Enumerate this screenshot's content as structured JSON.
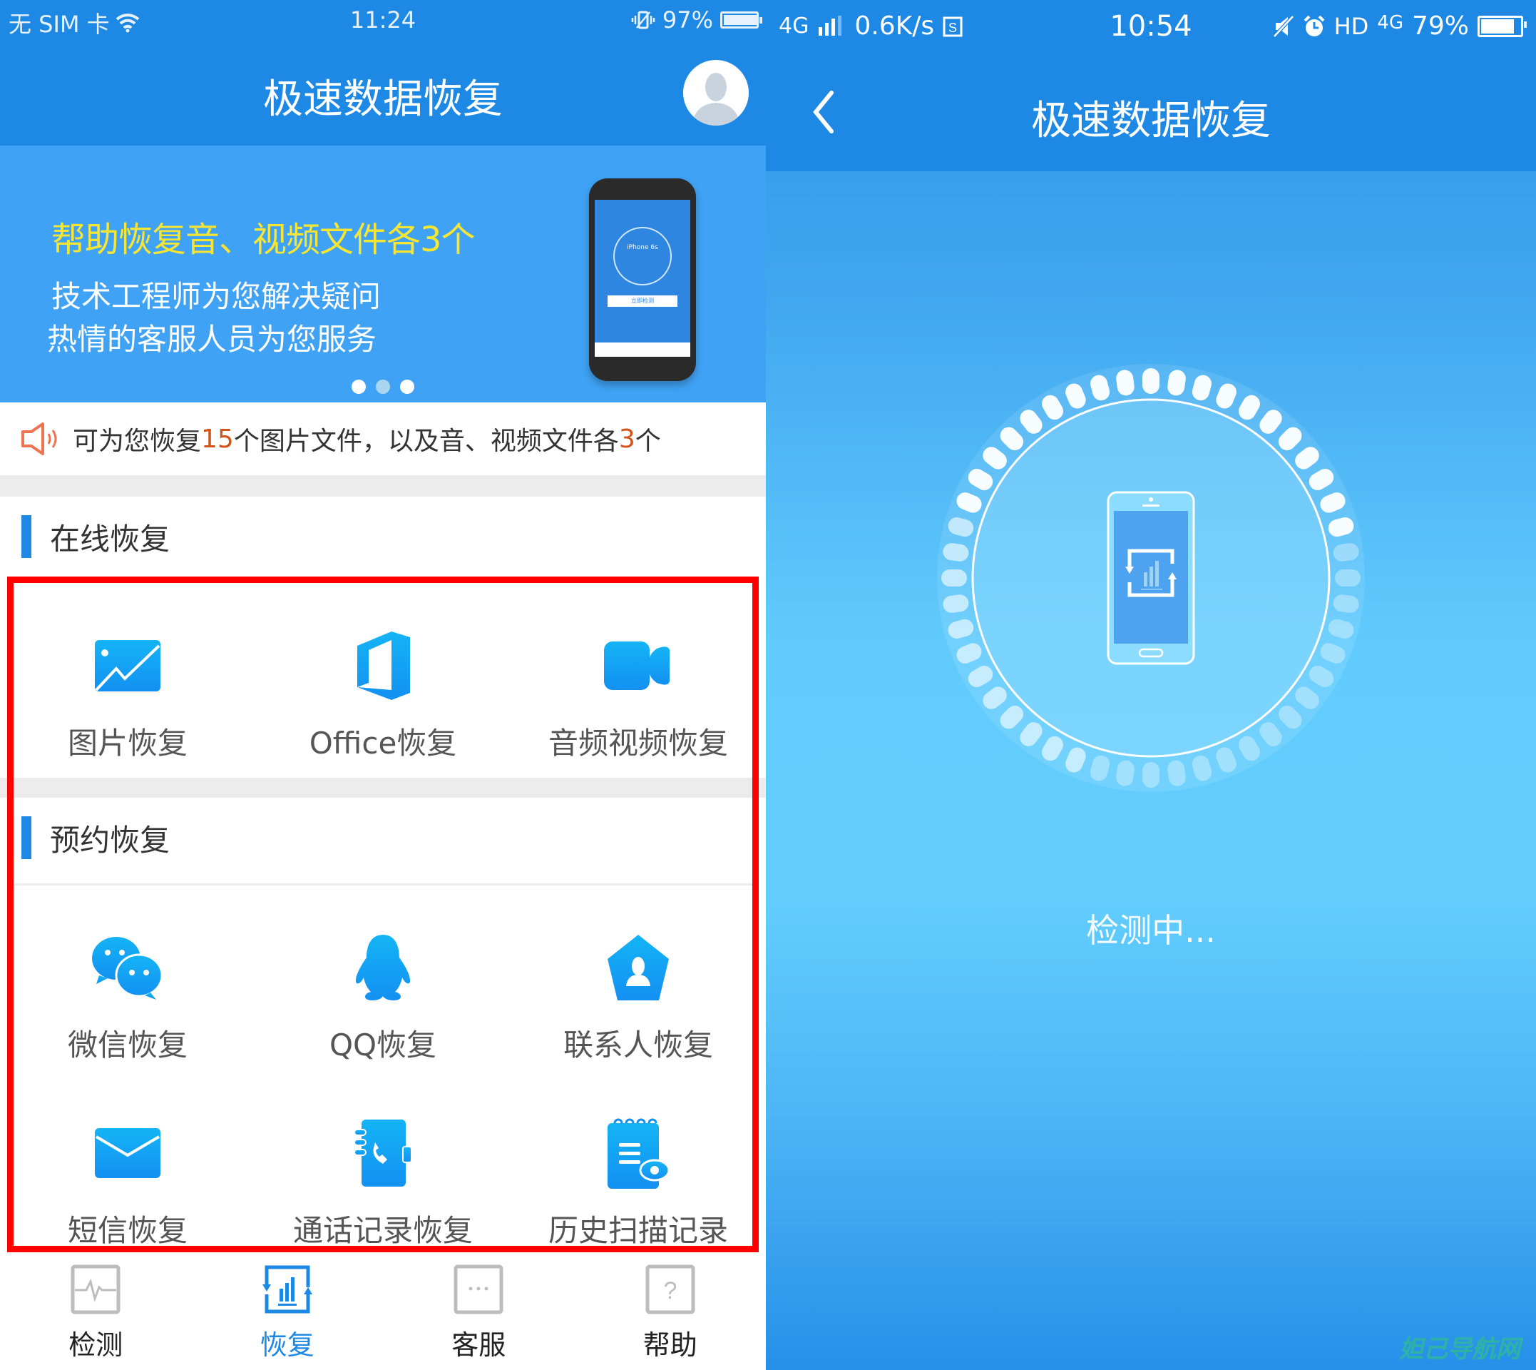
{
  "left_screen": {
    "status_bar": {
      "carrier": "无 SIM 卡",
      "wifi_icon": "wifi-icon",
      "time": "11:24",
      "vibrate_icon": "vibrate-icon",
      "battery": "97%",
      "battery_level": 0.97
    },
    "header": {
      "title": "极速数据恢复",
      "avatar_icon": "user-avatar-icon"
    },
    "banner": {
      "headline": "帮助恢复音、视频文件各3个",
      "line1": "技术工程师为您解决疑问",
      "line2": "热情的客服人员为您服务",
      "mock_phone": {
        "device": "iPhone 6s",
        "button": "立即检测"
      },
      "carousel": {
        "count": 3,
        "active_index": 1
      }
    },
    "notice": {
      "icon": "speaker-icon",
      "prefix": "可为您恢复",
      "photo_count": "15",
      "middle": "个图片文件，以及音、视频文件各",
      "media_count": "3",
      "suffix": "个"
    },
    "sections": [
      {
        "title": "在线恢复",
        "items": [
          {
            "label": "图片恢复",
            "icon": "image-icon"
          },
          {
            "label": "Office恢复",
            "icon": "office-icon"
          },
          {
            "label": "音频视频恢复",
            "icon": "video-camera-icon"
          }
        ]
      },
      {
        "title": "预约恢复",
        "items": [
          {
            "label": "微信恢复",
            "icon": "wechat-icon"
          },
          {
            "label": "QQ恢复",
            "icon": "qq-penguin-icon"
          },
          {
            "label": "联系人恢复",
            "icon": "contact-icon"
          },
          {
            "label": "短信恢复",
            "icon": "envelope-icon"
          },
          {
            "label": "通话记录恢复",
            "icon": "call-log-icon"
          },
          {
            "label": "历史扫描记录",
            "icon": "scan-history-icon"
          }
        ]
      }
    ],
    "tabbar": [
      {
        "label": "检测",
        "icon": "pulse-icon",
        "active": false
      },
      {
        "label": "恢复",
        "icon": "recover-chart-icon",
        "active": true
      },
      {
        "label": "客服",
        "icon": "chat-dots-icon",
        "active": false
      },
      {
        "label": "帮助",
        "icon": "help-question-icon",
        "active": false
      }
    ],
    "highlight_color": "#ff0000",
    "accent_color": "#1e88e5"
  },
  "right_screen": {
    "status_bar": {
      "network": "4G",
      "speed": "0.6K/s",
      "time": "10:54",
      "hd": "HD",
      "network2": "4G",
      "battery": "79%",
      "battery_level": 0.79
    },
    "header": {
      "title": "极速数据恢复",
      "back_icon": "chevron-left-icon"
    },
    "scan": {
      "icon": "phone-scan-icon",
      "status": "检测中...",
      "tick_count": 48
    },
    "watermark": "妲己导航网"
  }
}
